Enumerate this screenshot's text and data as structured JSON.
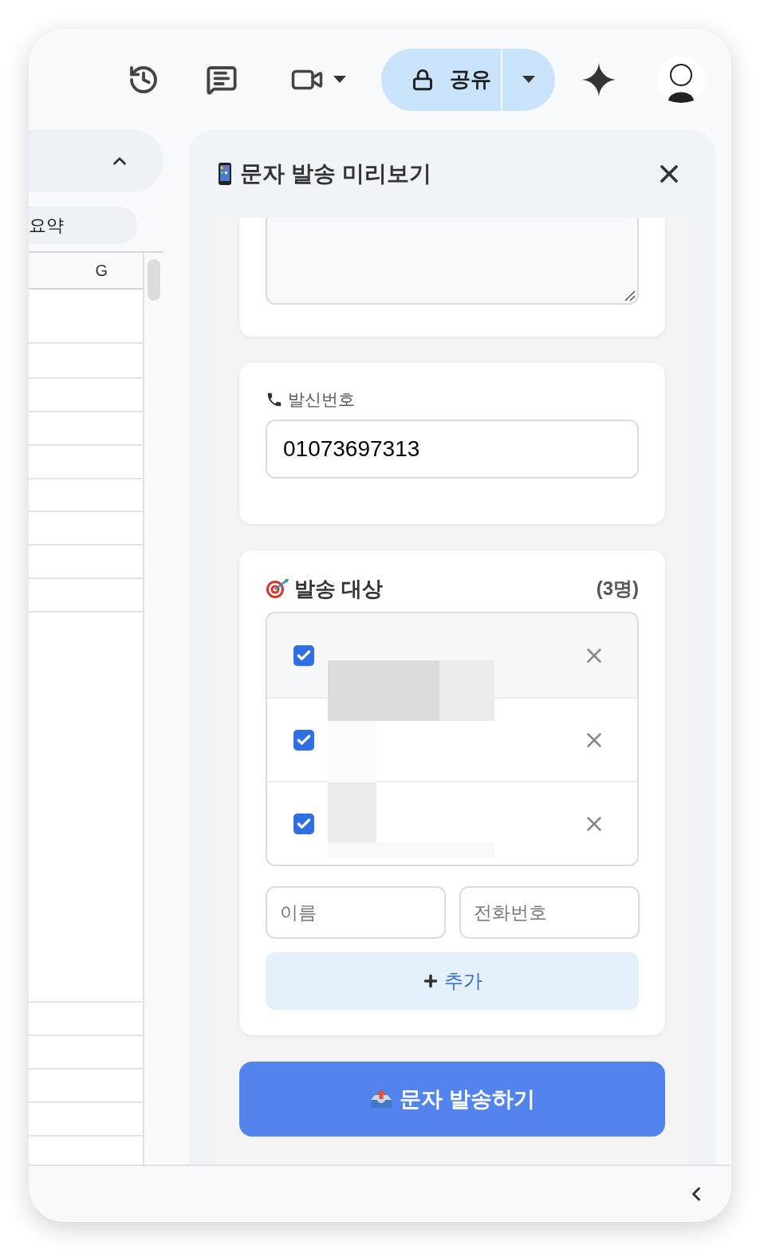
{
  "toolbar": {
    "share_button": {
      "label": "공유"
    }
  },
  "sheet": {
    "tab_label": "요약",
    "column_header": "G"
  },
  "panel": {
    "title": "문자 발송 미리보기",
    "sender": {
      "label": "발신번호",
      "value": "01073697313"
    },
    "recipients": {
      "title": "발송 대상",
      "count": "(3명)",
      "items": [
        {
          "checked": true
        },
        {
          "checked": true
        },
        {
          "checked": true
        }
      ],
      "name_field": {
        "placeholder": "이름"
      },
      "phone_field": {
        "placeholder": "전화번호"
      },
      "add_button": {
        "label": "추가"
      }
    },
    "send_button": {
      "label": "문자 발송하기"
    }
  }
}
